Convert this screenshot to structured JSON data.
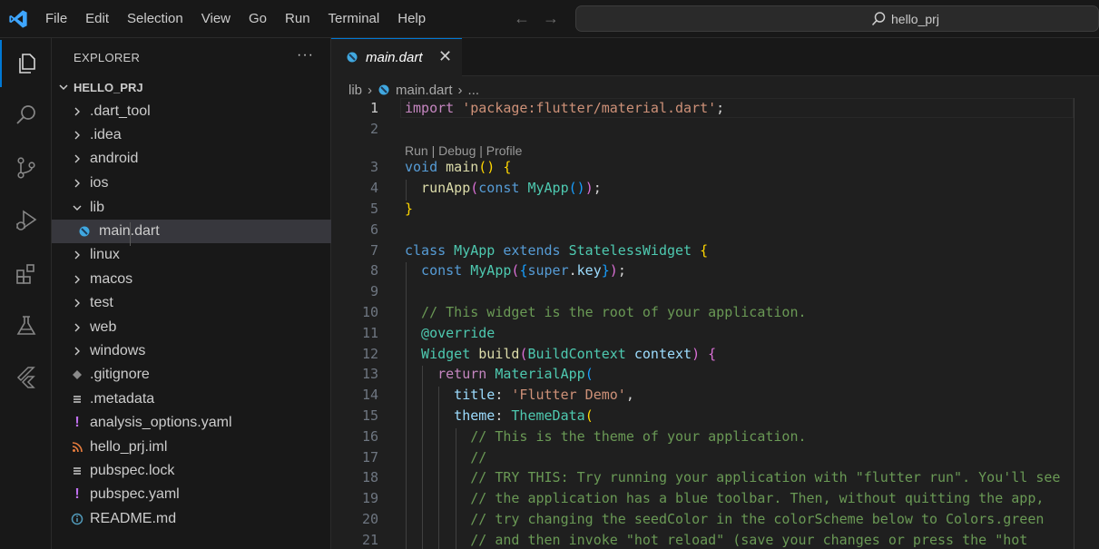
{
  "menu": [
    "File",
    "Edit",
    "Selection",
    "View",
    "Go",
    "Run",
    "Terminal",
    "Help"
  ],
  "search": {
    "text": "hello_prj"
  },
  "sidebar": {
    "header": "EXPLORER",
    "more": "···",
    "root": "HELLO_PRJ",
    "items": [
      {
        "label": ".dart_tool"
      },
      {
        "label": ".idea"
      },
      {
        "label": "android"
      },
      {
        "label": "ios"
      },
      {
        "label": "lib"
      },
      {
        "label": "main.dart"
      },
      {
        "label": "linux"
      },
      {
        "label": "macos"
      },
      {
        "label": "test"
      },
      {
        "label": "web"
      },
      {
        "label": "windows"
      },
      {
        "label": ".gitignore"
      },
      {
        "label": ".metadata"
      },
      {
        "label": "analysis_options.yaml"
      },
      {
        "label": "hello_prj.iml"
      },
      {
        "label": "pubspec.lock"
      },
      {
        "label": "pubspec.yaml"
      },
      {
        "label": "README.md"
      }
    ]
  },
  "tab": {
    "label": "main.dart",
    "close": "✕"
  },
  "breadcrumb": {
    "folder": "lib",
    "file": "main.dart",
    "more": "..."
  },
  "codelens": "Run | Debug | Profile",
  "line_numbers": [
    "1",
    "2",
    "3",
    "4",
    "5",
    "6",
    "7",
    "8",
    "9",
    "10",
    "11",
    "12",
    "13",
    "14",
    "15",
    "16",
    "17",
    "18",
    "19",
    "20",
    "21"
  ],
  "code": {
    "l1a": "import",
    "l1b": " 'package:flutter/material.dart'",
    "l1c": ";",
    "l3a": "void",
    "l3b": " main",
    "l3c": "()",
    "l3d": " {",
    "l4a": "  runApp",
    "l4b": "(",
    "l4c": "const",
    "l4d": " MyApp",
    "l4e": "()",
    "l4f": ")",
    "l4g": ";",
    "l5a": "}",
    "l7a": "class",
    "l7b": " MyApp",
    "l7c": " extends",
    "l7d": " StatelessWidget",
    "l7e": " {",
    "l8a": "  const",
    "l8b": " MyApp",
    "l8c": "(",
    "l8d": "{",
    "l8e": "super",
    "l8f": ".",
    "l8g": "key",
    "l8h": "}",
    "l8i": ")",
    "l8j": ";",
    "l10a": "  // This widget is the root of your application.",
    "l11a": "  @override",
    "l12a": "  Widget",
    "l12b": " build",
    "l12c": "(",
    "l12d": "BuildContext",
    "l12e": " context",
    "l12f": ")",
    "l12g": " {",
    "l13a": "    return",
    "l13b": " MaterialApp",
    "l13c": "(",
    "l14a": "      title",
    "l14b": ": ",
    "l14c": "'Flutter Demo'",
    "l14d": ",",
    "l15a": "      theme",
    "l15b": ": ",
    "l15c": "ThemeData",
    "l15d": "(",
    "l16a": "        // This is the theme of your application.",
    "l17a": "        //",
    "l18a": "        // TRY THIS: Try running your application with \"flutter run\". You'll see",
    "l19a": "        // the application has a blue toolbar. Then, without quitting the app,",
    "l20a": "        // try changing the seedColor in the colorScheme below to Colors.green",
    "l21a": "        // and then invoke \"hot reload\" (save your changes or press the \"hot"
  },
  "colors": {
    "accent": "#0078d4",
    "background": "#1f1f1f"
  }
}
